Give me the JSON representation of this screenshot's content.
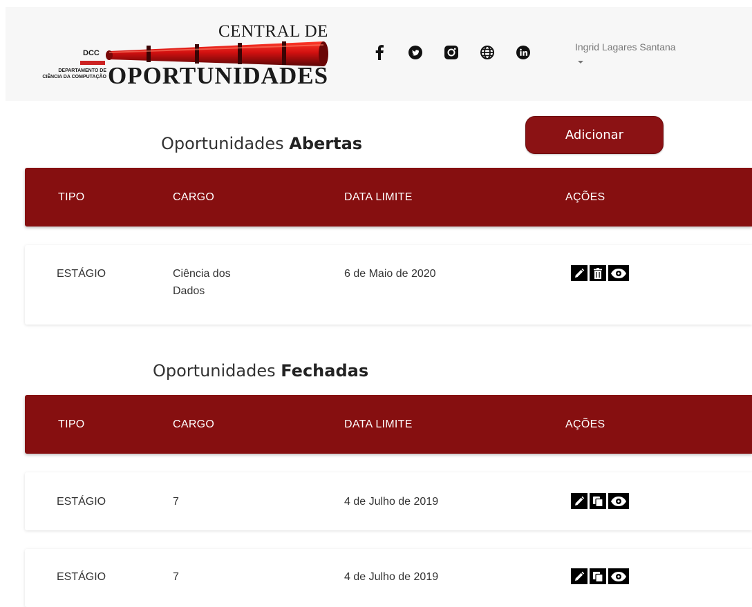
{
  "header": {
    "logo": {
      "line1": "CENTRAL DE",
      "line2": "OPORTUNIDADES",
      "dcc": "DCC",
      "dept_line1": "DEPARTAMENTO DE",
      "dept_line2": "CIÊNCIA DA COMPUTAÇÃO"
    },
    "social_icons": [
      "facebook-icon",
      "twitter-icon",
      "instagram-icon",
      "globe-icon",
      "linkedin-icon"
    ],
    "user_name": "Ingrid Lagares Santana"
  },
  "open_section": {
    "title_prefix": "Oportunidades ",
    "title_strong": "Abertas",
    "add_button": "Adicionar",
    "columns": {
      "tipo": "TIPO",
      "cargo": "CARGO",
      "data": "DATA LIMITE",
      "acoes": "AÇÕES"
    },
    "rows": [
      {
        "tipo": "ESTÁGIO",
        "cargo": "Ciência dos Dados",
        "data": "6 de Maio de 2020"
      }
    ]
  },
  "closed_section": {
    "title_prefix": "Oportunidades ",
    "title_strong": "Fechadas",
    "columns": {
      "tipo": "TIPO",
      "cargo": "CARGO",
      "data": "DATA LIMITE",
      "acoes": "AÇÕES"
    },
    "rows": [
      {
        "tipo": "ESTÁGIO",
        "cargo": "7",
        "data": "4 de Julho de 2019"
      },
      {
        "tipo": "ESTÁGIO",
        "cargo": "7",
        "data": "4 de Julho de 2019"
      }
    ]
  },
  "colors": {
    "brand": "#860f10",
    "header_bg": "#f7f7f7",
    "text": "#333333"
  }
}
